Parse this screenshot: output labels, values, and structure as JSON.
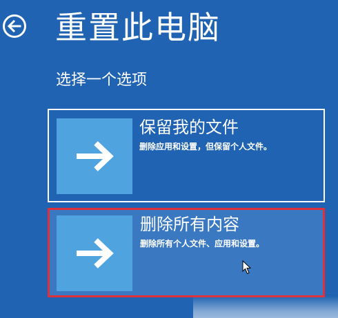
{
  "header": {
    "title": "重置此电脑",
    "back_icon": "back-arrow-icon"
  },
  "subtitle": "选择一个选项",
  "options": [
    {
      "title": "保留我的文件",
      "description": "删除应用和设置，但保留个人文件。",
      "icon": "arrow-right-icon",
      "selected": false
    },
    {
      "title": "删除所有内容",
      "description": "删除所有个人文件、应用和设置。",
      "icon": "arrow-right-icon",
      "selected": true
    }
  ],
  "colors": {
    "background": "#1f63b2",
    "tile": "#4fa3de",
    "selected_background": "#3a79c1",
    "selected_border": "#e0303a",
    "text": "#ffffff"
  }
}
